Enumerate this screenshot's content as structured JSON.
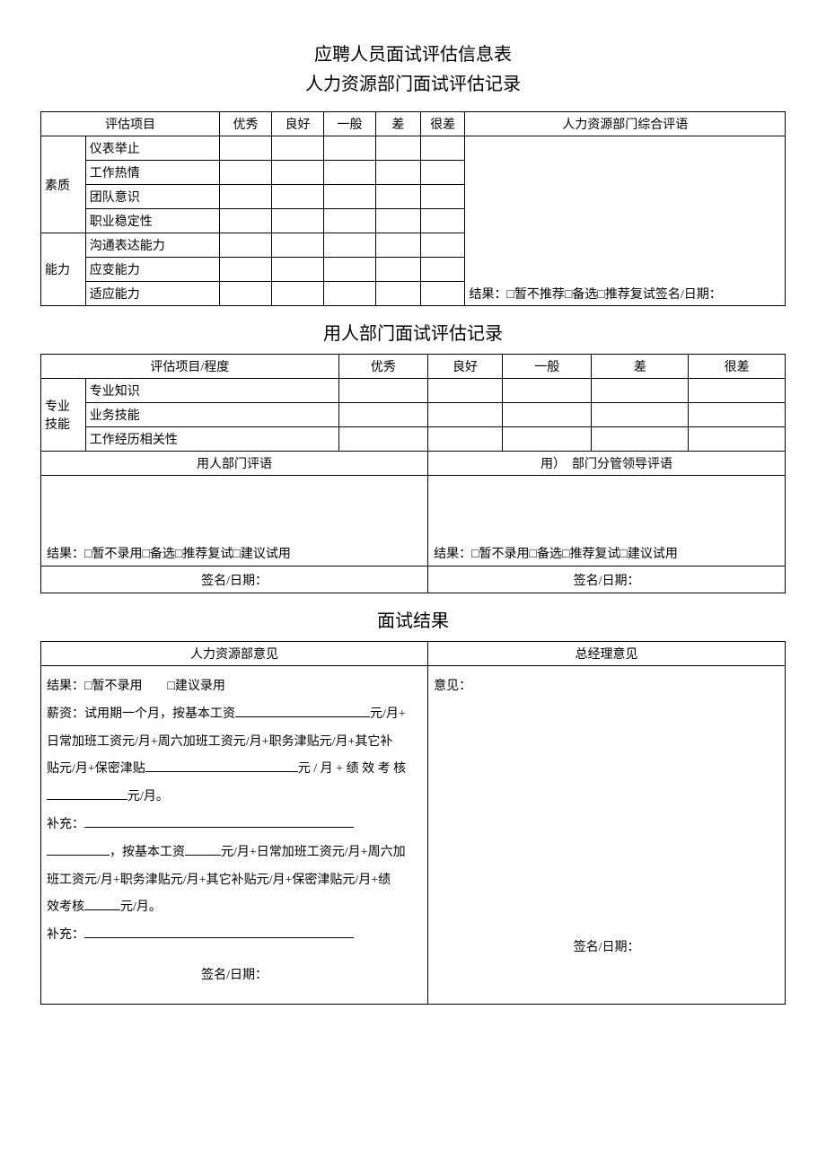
{
  "titles": {
    "main": "应聘人员面试评估信息表",
    "sub": "人力资源部门面试评估记录",
    "section2": "用人部门面试评估记录",
    "section3": "面试结果"
  },
  "table1": {
    "header": {
      "eval_item": "评估项目",
      "excellent": "优秀",
      "good": "良好",
      "average": "一般",
      "poor": "差",
      "vpoor": "很差",
      "hr_comments": "人力资源部门综合评语"
    },
    "rowgroup1": "素质",
    "rowgroup2": "能力",
    "rows": {
      "r1": "仪表举止",
      "r2": "工作热情",
      "r3": "团队意识",
      "r4": "职业稳定性",
      "r5": "沟通表达能力",
      "r6": "应变能力",
      "r7": "适应能力"
    },
    "hr_result": "结果：□暂不推荐□备选□推荐复试签名/日期："
  },
  "table2": {
    "header": {
      "eval_item": "评估项目/程度",
      "excellent": "优秀",
      "good": "良好",
      "average": "一般",
      "poor": "差",
      "vpoor": "很差"
    },
    "rowgroup": "专业技能",
    "rows": {
      "r1": "专业知识",
      "r2": "业务技能",
      "r3": "工作经历相关性"
    },
    "dept_comments_hdr": "用人部门评语",
    "leader_comments_pre": "用）",
    "leader_comments_hdr": "部门分管领导评语",
    "result_left": "结果：□暂不录用□备选□推荐复试□建议试用",
    "result_right": "结果：□暂不录用□备选□推荐复试□建议试用",
    "sig_left": "签名/日期：",
    "sig_right": "签名/日期："
  },
  "table3": {
    "hr_opinion_hdr": "人力资源部意见",
    "gm_opinion_hdr": "总经理意见",
    "left": {
      "line1_a": "结果：□暂不录用",
      "line1_b": "□建议录用",
      "line2_a": "薪资：试用期一个月，按基本工资",
      "line2_b": "元/月+",
      "line3": "日常加班工资元/月+周六加班工资元/月+职务津贴元/月+其它补",
      "line4_a": "贴元/月+保密津贴",
      "line4_b": "元 / 月 + 绩 效 考 核",
      "line5_a": "",
      "line5_b": "元/月。",
      "line6": "补充：",
      "line7_a": "",
      "line7_b": "，按基本工资",
      "line7_c": "元/月+日常加班工资元/月+周六加",
      "line8": "班工资元/月+职务津贴元/月+其它补贴元/月+保密津贴元/月+绩",
      "line9_a": "效考核",
      "line9_b": "元/月。",
      "line10": "补充：",
      "sig": "签名/日期："
    },
    "right": {
      "opinion_label": "意见：",
      "sig": "签名/日期："
    }
  }
}
